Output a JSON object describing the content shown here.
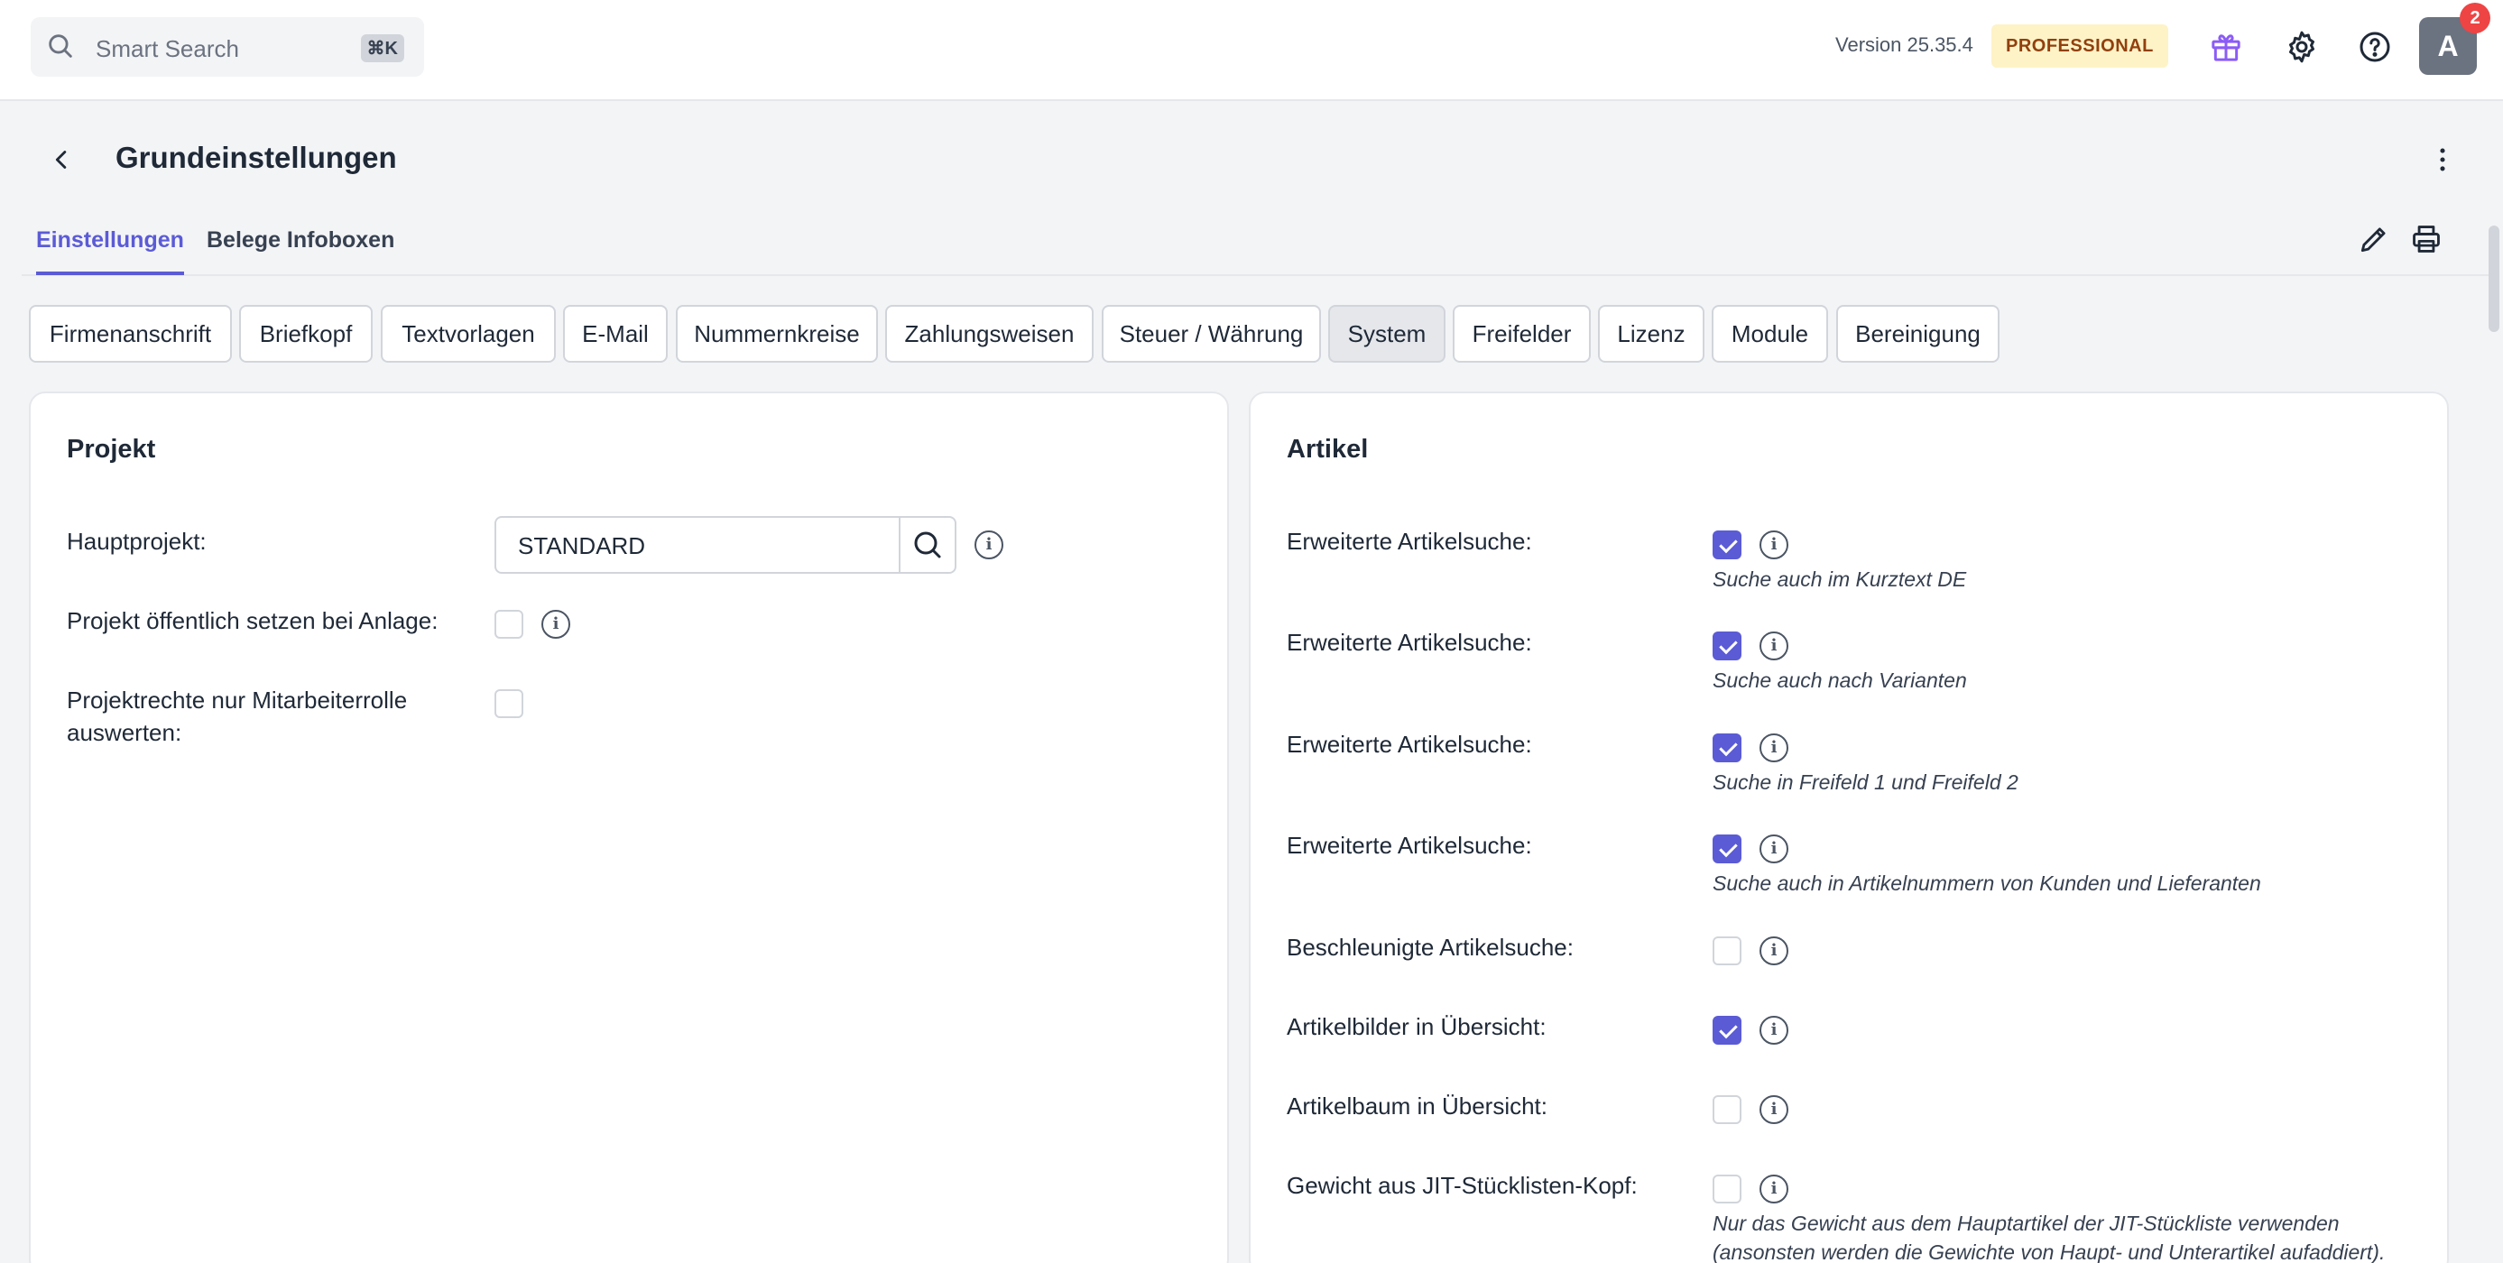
{
  "topbar": {
    "search_placeholder": "Smart Search",
    "search_shortcut": "⌘K",
    "version": "Version 25.35.4",
    "plan_badge": "PROFESSIONAL",
    "avatar_initial": "A",
    "notification_count": "2",
    "icons": [
      "search-icon",
      "gift-icon",
      "gear-icon",
      "help-icon"
    ]
  },
  "page": {
    "title": "Grundeinstellungen",
    "tabs": [
      {
        "label": "Einstellungen",
        "active": true
      },
      {
        "label": "Belege Infoboxen",
        "active": false
      }
    ]
  },
  "subnav": [
    {
      "label": "Firmenanschrift"
    },
    {
      "label": "Briefkopf"
    },
    {
      "label": "Textvorlagen"
    },
    {
      "label": "E-Mail"
    },
    {
      "label": "Nummernkreise"
    },
    {
      "label": "Zahlungsweisen"
    },
    {
      "label": "Steuer / Währung"
    },
    {
      "label": "System",
      "active": true
    },
    {
      "label": "Freifelder"
    },
    {
      "label": "Lizenz"
    },
    {
      "label": "Module"
    },
    {
      "label": "Bereinigung"
    }
  ],
  "projekt": {
    "title": "Projekt",
    "hauptprojekt_label": "Hauptprojekt:",
    "hauptprojekt_value": "STANDARD",
    "oeffentlich_label": "Projekt öffentlich setzen bei Anlage:",
    "oeffentlich_checked": false,
    "rechte_label_1": "Projektrechte nur Mitarbeiterrolle",
    "rechte_label_2": "auswerten:",
    "rechte_checked": false
  },
  "artikel": {
    "title": "Artikel",
    "rows": [
      {
        "label": "Erweiterte Artikelsuche:",
        "checked": true,
        "hint": "Suche auch im Kurztext DE"
      },
      {
        "label": "Erweiterte Artikelsuche:",
        "checked": true,
        "hint": "Suche auch nach Varianten"
      },
      {
        "label": "Erweiterte Artikelsuche:",
        "checked": true,
        "hint": "Suche in Freifeld 1 und Freifeld 2"
      },
      {
        "label": "Erweiterte Artikelsuche:",
        "checked": true,
        "hint": "Suche auch in Artikelnummern von Kunden und Lieferanten"
      },
      {
        "label": "Beschleunigte Artikelsuche:",
        "checked": false,
        "hint": ""
      },
      {
        "label": "Artikelbilder in Übersicht:",
        "checked": true,
        "hint": ""
      },
      {
        "label": "Artikelbaum in Übersicht:",
        "checked": false,
        "hint": ""
      },
      {
        "label": "Gewicht aus JIT-Stücklisten-Kopf:",
        "checked": false,
        "hint": "Nur das Gewicht aus dem Hauptartikel der JIT-Stückliste verwenden",
        "hint2": "(ansonsten werden die Gewichte von Haupt- und Unterartikel aufaddiert)."
      }
    ]
  },
  "info_glyph": "i"
}
